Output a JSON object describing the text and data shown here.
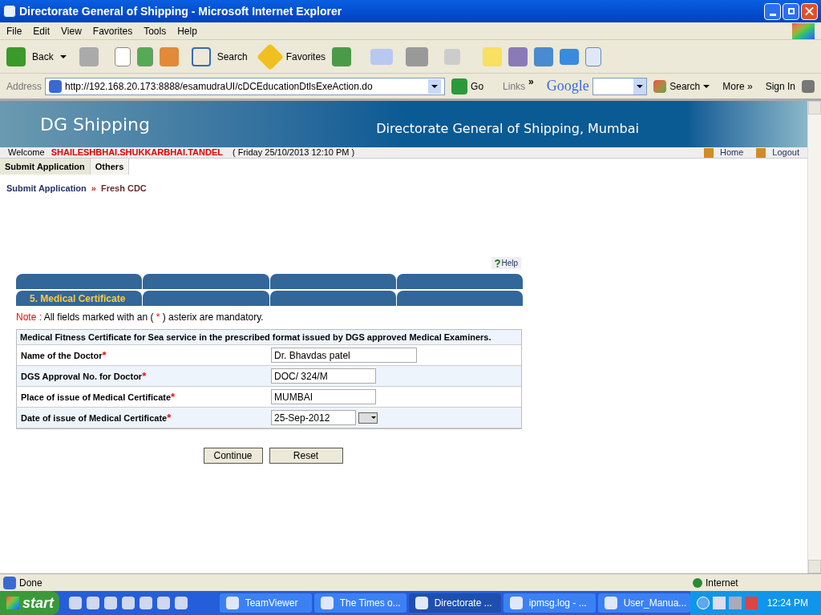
{
  "window": {
    "title": "Directorate General of Shipping - Microsoft Internet Explorer"
  },
  "menu": [
    "File",
    "Edit",
    "View",
    "Favorites",
    "Tools",
    "Help"
  ],
  "toolbar": {
    "back": "Back",
    "search": "Search",
    "favorites": "Favorites"
  },
  "address_bar": {
    "label": "Address",
    "url": "http://192.168.20.173:8888/esamudraUI/cDCEducationDtlsExeAction.do",
    "go": "Go",
    "links": "Links",
    "links_chevron": "»",
    "google_logo": "Google",
    "search": "Search",
    "more": "More »",
    "sign_in": "Sign In"
  },
  "header": {
    "logo": "DG Shipping",
    "title": "Directorate General of Shipping, Mumbai"
  },
  "welcome": {
    "label": "Welcome",
    "user": "SHAILESHBHAI.SHUKKARBHAI.TANDEL",
    "datetime": "( Friday 25/10/2013 12:10 PM )",
    "links": [
      "Home",
      "Logout"
    ]
  },
  "nav": [
    {
      "label": "Submit Application",
      "selected": true
    },
    {
      "label": "Others",
      "selected": false
    }
  ],
  "breadcrumb": {
    "items": [
      "Submit Application",
      "Fresh CDC"
    ],
    "separator": "»"
  },
  "help": "Help",
  "tabs": [
    {
      "label": "5. Medical Certificate",
      "selected": true
    }
  ],
  "note": {
    "prefix": "Note :",
    "before": "All fields marked with an (",
    "mark": "*",
    "after": ") asterix are mandatory."
  },
  "form": {
    "heading": "Medical Fitness Certificate for Sea service in the prescribed format issued by DGS approved Medical Examiners.",
    "fields": [
      {
        "label": "Name of the Doctor",
        "required": true,
        "value": "Dr. Bhavdas patel",
        "kind": "text"
      },
      {
        "label": "DGS Approval No. for Doctor",
        "required": true,
        "value": "DOC/ 324/M",
        "kind": "short"
      },
      {
        "label": "Place of issue of Medical Certificate",
        "required": true,
        "value": "MUMBAI",
        "kind": "short"
      },
      {
        "label": "Date of issue of Medical Certificate",
        "required": true,
        "value": "25-Sep-2012",
        "kind": "date"
      }
    ]
  },
  "buttons": [
    "Continue",
    "Reset"
  ],
  "status_bar": {
    "status": "Done",
    "zone": "Internet"
  },
  "taskbar": {
    "start": "start",
    "tasks": [
      {
        "label": "TeamViewer",
        "selected": false
      },
      {
        "label": "The Times o...",
        "selected": false
      },
      {
        "label": "Directorate ...",
        "selected": true
      },
      {
        "label": "ipmsg.log - ...",
        "selected": false
      },
      {
        "label": "User_Manua...",
        "selected": false
      }
    ],
    "clock": "12:24 PM"
  }
}
